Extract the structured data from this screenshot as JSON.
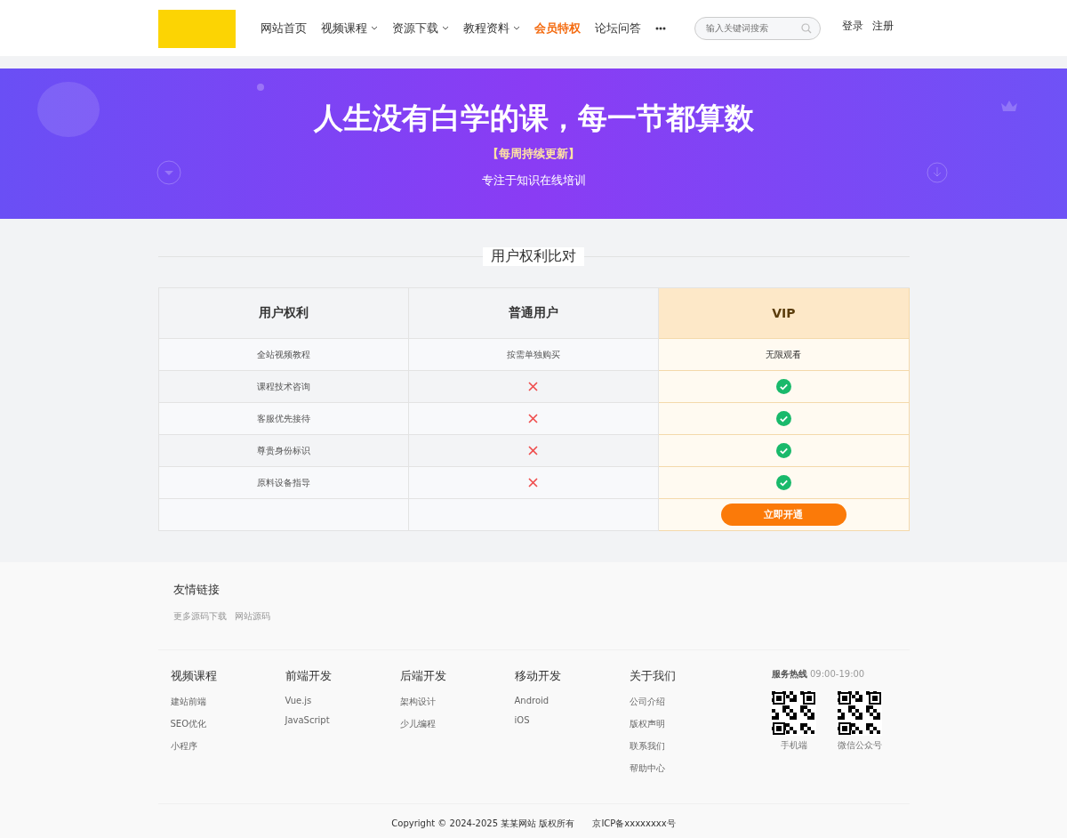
{
  "header": {
    "nav": [
      {
        "label": "网站首页",
        "dropdown": false,
        "selected": false
      },
      {
        "label": "视频课程",
        "dropdown": true,
        "selected": false
      },
      {
        "label": "资源下载",
        "dropdown": true,
        "selected": false
      },
      {
        "label": "教程资料",
        "dropdown": true,
        "selected": false
      },
      {
        "label": "会员特权",
        "dropdown": false,
        "selected": true
      },
      {
        "label": "论坛问答",
        "dropdown": false,
        "selected": false
      }
    ],
    "search": {
      "placeholder": "输入关键词搜索"
    },
    "auth": [
      "登录",
      "注册"
    ]
  },
  "banner": {
    "title": "人生没有白学的课，每一节都算数",
    "tag": "【每周持续更新】",
    "subtitle": "专注于知识在线培训"
  },
  "comparison": {
    "title": "用户权利比对",
    "columns": [
      "用户权利",
      "普通用户",
      "VIP"
    ],
    "rows": [
      {
        "feature": "全站视频教程",
        "normal": {
          "kind": "text",
          "text": "按需单独购买"
        },
        "vip": {
          "kind": "text",
          "text": "无限观看"
        }
      },
      {
        "feature": "课程技术咨询",
        "normal": {
          "kind": "cross"
        },
        "vip": {
          "kind": "check"
        }
      },
      {
        "feature": "客服优先接待",
        "normal": {
          "kind": "cross"
        },
        "vip": {
          "kind": "check"
        }
      },
      {
        "feature": "尊贵身份标识",
        "normal": {
          "kind": "cross"
        },
        "vip": {
          "kind": "check"
        }
      },
      {
        "feature": "原料设备指导",
        "normal": {
          "kind": "cross"
        },
        "vip": {
          "kind": "check"
        }
      }
    ],
    "button": "立即开通"
  },
  "friend_links": {
    "title": "友情链接",
    "links": [
      "更多源码下载",
      "网站源码"
    ]
  },
  "footer": {
    "columns": [
      {
        "title": "视频课程",
        "links": [
          "建站前端",
          "SEO优化",
          "小程序"
        ]
      },
      {
        "title": "前端开发",
        "links": [
          "Vue.js",
          "JavaScript"
        ]
      },
      {
        "title": "后端开发",
        "links": [
          "架构设计",
          "少儿编程"
        ]
      },
      {
        "title": "移动开发",
        "links": [
          "Android",
          "iOS"
        ]
      },
      {
        "title": "关于我们",
        "links": [
          "公司介绍",
          "版权声明",
          "联系我们",
          "帮助中心"
        ]
      }
    ],
    "hotline_label": "服务热线",
    "hotline_hours": "09:00-19:00",
    "qr_codes": [
      "手机端",
      "微信公众号"
    ],
    "copyright": "Copyright © 2024-2025 某某网站 版权所有",
    "icp": "京ICP备xxxxxxxx号"
  }
}
